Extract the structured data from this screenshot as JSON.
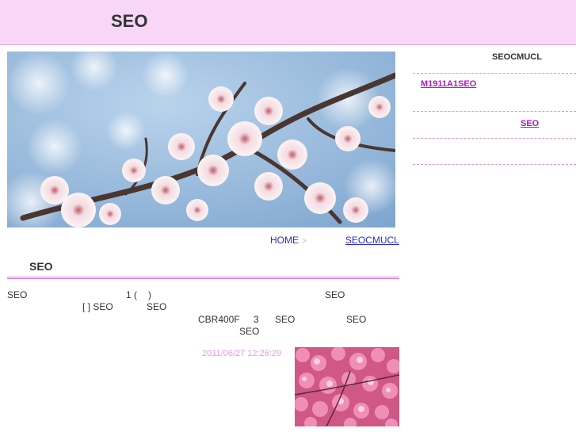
{
  "header": {
    "site_title": "SEO"
  },
  "breadcrumb": {
    "home": "HOME",
    "separator": ">",
    "current": "SEOCMUCL"
  },
  "entry": {
    "title": "SEO",
    "lines": [
      [
        "SEO",
        "1 (",
        ")",
        "SEO"
      ],
      [
        "[ ] SEO",
        "SEO"
      ],
      [
        "CBR400F",
        "3",
        "SEO",
        "SEO"
      ],
      [
        "SEO"
      ]
    ],
    "timestamp": "2011/06/27 12:26:29"
  },
  "sidebar": {
    "title": "SEOCMUCL",
    "links": [
      "M1911A1SEO",
      "SEO"
    ]
  },
  "colors": {
    "header_bg": "#f7d6f7",
    "link": "#2a2acf",
    "sidebar_link": "#b019c0",
    "timestamp": "#e99ae9",
    "rule": "#d37ad3"
  }
}
